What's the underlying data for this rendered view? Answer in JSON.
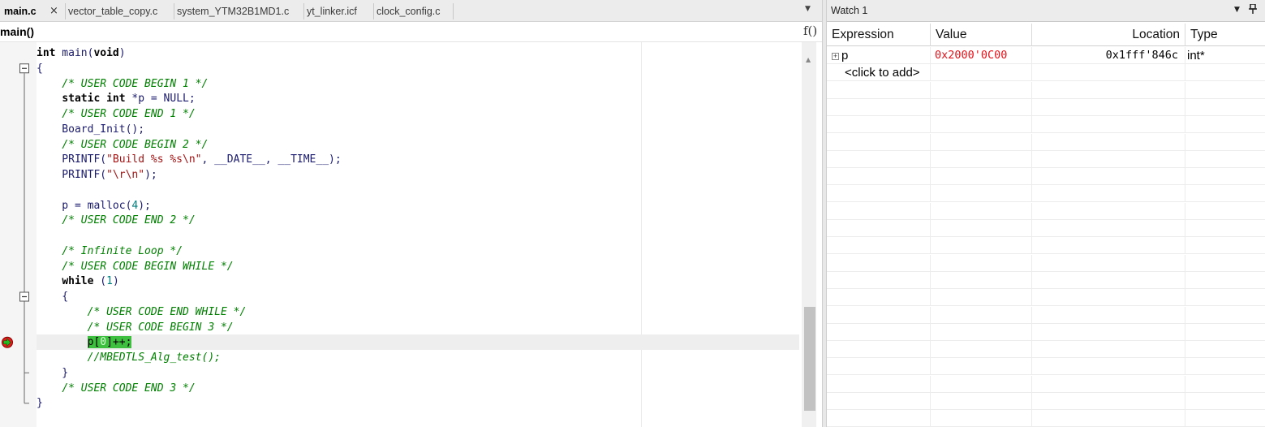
{
  "editor": {
    "tabs": [
      {
        "label": "main.c",
        "active": true
      },
      {
        "label": "vector_table_copy.c",
        "active": false
      },
      {
        "label": "system_YTM32B1MD1.c",
        "active": false
      },
      {
        "label": "yt_linker.icf",
        "active": false
      },
      {
        "label": "clock_config.c",
        "active": false
      }
    ],
    "tab_close_glyph": "×",
    "function_name": "main()",
    "function_icon_glyph": "f()",
    "current_line_index": 19,
    "breakpoint_line_index": 19,
    "code_lines": [
      [
        {
          "t": "int",
          "c": "kw"
        },
        {
          "t": " main("
        },
        {
          "t": "void",
          "c": "kw"
        },
        {
          "t": ")"
        }
      ],
      [
        {
          "t": "{"
        }
      ],
      [
        {
          "t": "    "
        },
        {
          "t": "/* USER CODE BEGIN 1 */",
          "c": "cm"
        }
      ],
      [
        {
          "t": "    "
        },
        {
          "t": "static",
          "c": "kw"
        },
        {
          "t": " "
        },
        {
          "t": "int",
          "c": "kw"
        },
        {
          "t": " *p = NULL;"
        }
      ],
      [
        {
          "t": "    "
        },
        {
          "t": "/* USER CODE END 1 */",
          "c": "cm"
        }
      ],
      [
        {
          "t": "    Board_Init();"
        }
      ],
      [
        {
          "t": "    "
        },
        {
          "t": "/* USER CODE BEGIN 2 */",
          "c": "cm"
        }
      ],
      [
        {
          "t": "    PRINTF("
        },
        {
          "t": "\"Build %s %s\\n\"",
          "c": "str"
        },
        {
          "t": ", __DATE__, __TIME__);"
        }
      ],
      [
        {
          "t": "    PRINTF("
        },
        {
          "t": "\"\\r\\n\"",
          "c": "str"
        },
        {
          "t": ");"
        }
      ],
      [],
      [
        {
          "t": "    p = malloc("
        },
        {
          "t": "4",
          "c": "num"
        },
        {
          "t": ");"
        }
      ],
      [
        {
          "t": "    "
        },
        {
          "t": "/* USER CODE END 2 */",
          "c": "cm"
        }
      ],
      [],
      [
        {
          "t": "    "
        },
        {
          "t": "/* Infinite Loop */",
          "c": "cm"
        }
      ],
      [
        {
          "t": "    "
        },
        {
          "t": "/* USER CODE BEGIN WHILE */",
          "c": "cm"
        }
      ],
      [
        {
          "t": "    "
        },
        {
          "t": "while",
          "c": "kw"
        },
        {
          "t": " ("
        },
        {
          "t": "1",
          "c": "num"
        },
        {
          "t": ")"
        }
      ],
      [
        {
          "t": "    {"
        }
      ],
      [
        {
          "t": "        "
        },
        {
          "t": "/* USER CODE END WHILE */",
          "c": "cm"
        }
      ],
      [
        {
          "t": "        "
        },
        {
          "t": "/* USER CODE BEGIN 3 */",
          "c": "cm"
        }
      ],
      [
        {
          "t": "        "
        },
        {
          "t": "p[",
          "c": "hl"
        },
        {
          "t": "0",
          "c": "hlnum"
        },
        {
          "t": "]++;",
          "c": "hl"
        }
      ],
      [
        {
          "t": "        "
        },
        {
          "t": "//MBEDTLS_Alg_test();",
          "c": "cm"
        }
      ],
      [
        {
          "t": "    }"
        }
      ],
      [
        {
          "t": "    "
        },
        {
          "t": "/* USER CODE END 3 */",
          "c": "cm"
        }
      ],
      [
        {
          "t": "}"
        }
      ]
    ],
    "fold_markers": [
      {
        "line": 1,
        "kind": "open"
      },
      {
        "line": 16,
        "kind": "open"
      },
      {
        "line": 21,
        "kind": "end"
      },
      {
        "line": 23,
        "kind": "end"
      }
    ]
  },
  "watch": {
    "title": "Watch 1",
    "dropdown_glyph": "▼",
    "pin_glyph": "📌",
    "columns": {
      "expression": "Expression",
      "value": "Value",
      "location": "Location",
      "type": "Type"
    },
    "rows": [
      {
        "expander": "+",
        "expression": "p",
        "value": "0x2000'0C00",
        "location": "0x1fff'846c",
        "type": "int*",
        "value_changed": true
      },
      {
        "expander": "",
        "expression": "<click to add>",
        "value": "",
        "location": "",
        "type": "",
        "value_changed": false
      }
    ],
    "empty_row_count": 20
  },
  "colors": {
    "keyword": "#000000",
    "comment": "#008000",
    "string": "#a31515",
    "number": "#008080",
    "changed_value": "#e8121a",
    "current_statement": "#3fbf3f",
    "breakpoint": "#e01c1c",
    "pc_arrow": "#1fbf1f"
  }
}
